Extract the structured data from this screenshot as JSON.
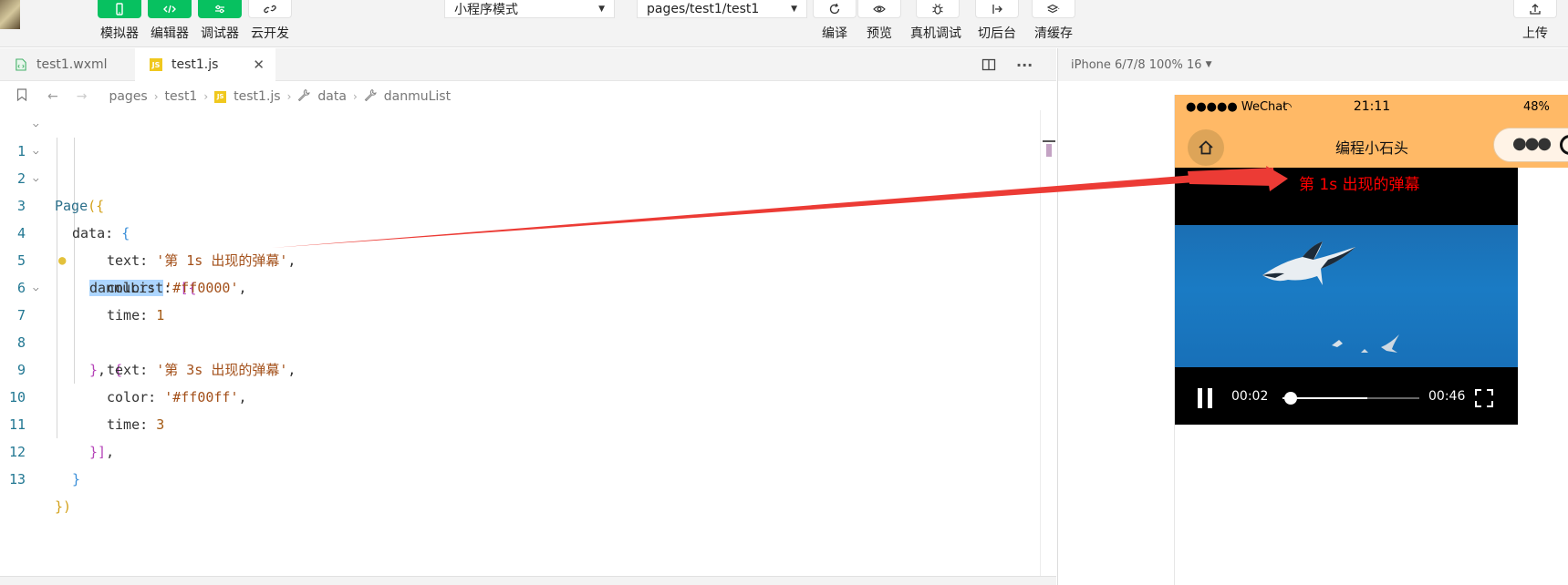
{
  "toolbar": {
    "buttons": [
      {
        "label": "模拟器",
        "icon": "phone-icon"
      },
      {
        "label": "编辑器",
        "icon": "code-icon"
      },
      {
        "label": "调试器",
        "icon": "sliders-icon"
      },
      {
        "label": "云开发",
        "icon": "cloud-link-icon"
      }
    ],
    "mode_select": "小程序模式",
    "page_select": "pages/test1/test1",
    "actions": [
      {
        "label": "编译",
        "icon": "refresh-icon"
      },
      {
        "label": "预览",
        "icon": "eye-icon"
      },
      {
        "label": "真机调试",
        "icon": "bug-icon"
      },
      {
        "label": "切后台",
        "icon": "switch-background-icon"
      },
      {
        "label": "清缓存",
        "icon": "layers-icon"
      }
    ],
    "upload_label": "上传"
  },
  "editor": {
    "tabs": [
      {
        "label": "test1.wxml",
        "active": false
      },
      {
        "label": "test1.js",
        "active": true
      }
    ],
    "breadcrumb": [
      "pages",
      "test1",
      "test1.js",
      "data",
      "danmuList"
    ],
    "line_numbers": [
      "1",
      "2",
      "3",
      "4",
      "5",
      "6",
      "7",
      "8",
      "9",
      "10",
      "11",
      "12",
      "13"
    ],
    "code": {
      "l1_kw": "Page",
      "l1_open": "({",
      "l2_kw": "data",
      "l2_colon": ": ",
      "l2_open": "{",
      "l3_kw": "danmuList",
      "l3_colon": ": ",
      "l3_open": "[{",
      "l4_key": "text",
      "l4_val": "'第 1s 出现的弹幕'",
      "l5_key": "color",
      "l5_val": "'#ff0000'",
      "l6_key": "time",
      "l6_val": "1",
      "l7_a": "}",
      "l7_b": ", ",
      "l7_c": "{",
      "l8_key": "text",
      "l8_val": "'第 3s 出现的弹幕'",
      "l9_key": "color",
      "l9_val": "'#ff00ff'",
      "l10_key": "time",
      "l10_val": "3",
      "l11_close": "}]",
      "l12_close": "}",
      "l13_a": "}",
      "l13_b": ")",
      "colon": ": ",
      "comma": ","
    }
  },
  "simulator": {
    "device": "iPhone 6/7/8 100% 16",
    "status": {
      "carrier": "●●●●● WeChat",
      "time": "21:11",
      "battery": "48%"
    },
    "nav_title": "编程小石头",
    "video": {
      "danmu_text": "第 1s 出现的弹幕",
      "danmu_color": "#ff0000",
      "current_time": "00:02",
      "duration": "00:46",
      "progress": 0.04,
      "buffered": 0.62
    }
  }
}
